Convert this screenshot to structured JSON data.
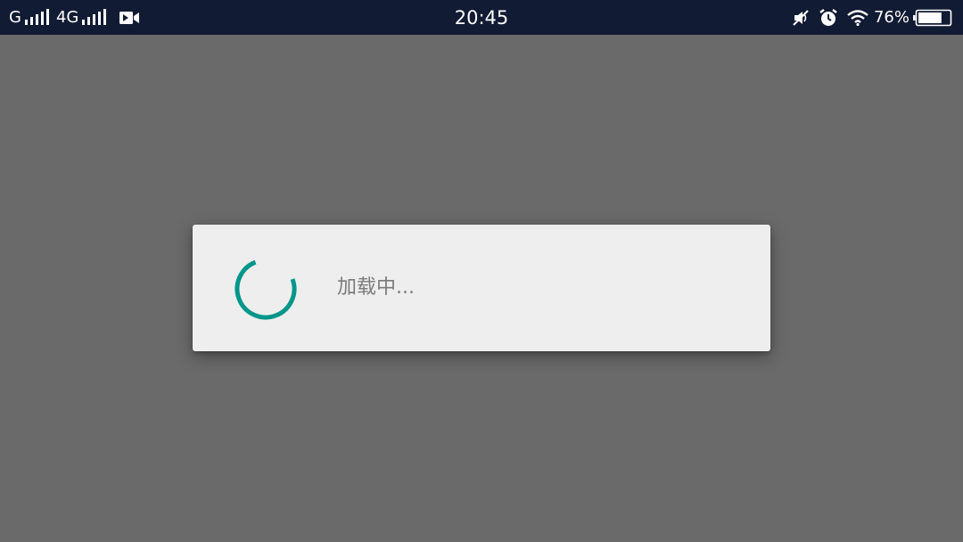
{
  "status_bar": {
    "carrier1": "G",
    "carrier2": "4G",
    "time": "20:45",
    "battery_percent": "76%",
    "battery_level": 0.76,
    "icons": [
      "video-icon",
      "mute-icon",
      "alarm-icon",
      "wifi-icon",
      "battery-icon"
    ],
    "background": "#111b33"
  },
  "dialog": {
    "loading_text": "加载中...",
    "spinner_color": "#00968a",
    "background": "#eeeeee"
  },
  "overlay_color": "#6a6a6a"
}
